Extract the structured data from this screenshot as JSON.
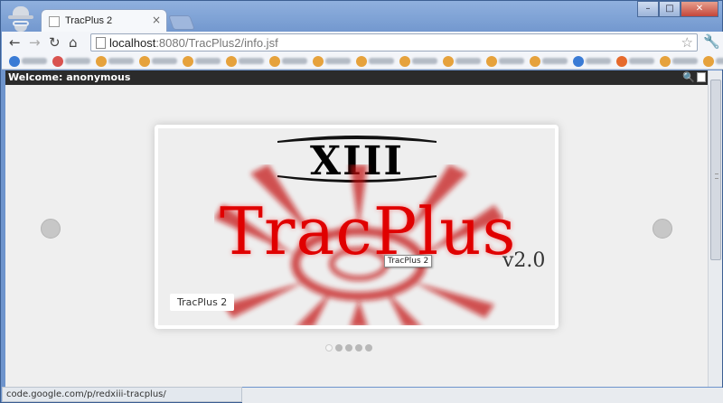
{
  "browser": {
    "tab_title": "TracPlus 2",
    "tab_close": "×",
    "url_host": "localhost",
    "url_rest": ":8080/TracPlus2/info.jsf",
    "window_controls": {
      "minimize": "–",
      "maximize": "□",
      "close": "✕"
    },
    "nav": {
      "back": "←",
      "forward": "→",
      "reload": "↻",
      "home": "⌂",
      "star": "☆",
      "wrench": "🔧"
    },
    "status_text": "code.google.com/p/redxiii-tracplus/"
  },
  "bookmark_icon_colors": [
    "#3a7bd5",
    "#d9534f",
    "#e6a23c",
    "#e6a23c",
    "#e6a23c",
    "#e6a23c",
    "#e6a23c",
    "#e6a23c",
    "#e6a23c",
    "#e6a23c",
    "#e6a23c",
    "#e6a23c",
    "#e6a23c",
    "#3a7bd5",
    "#e66a2c",
    "#e6a23c",
    "#e6a23c"
  ],
  "page": {
    "welcome": "Welcome: anonymous",
    "slider": {
      "logo_text": "XIII",
      "title": "TracPlus",
      "version": "v2.0",
      "tooltip": "TracPlus 2",
      "caption": "TracPlus 2",
      "dot_count": 5,
      "active_dot": 0
    }
  },
  "colors": {
    "title_red": "#e00000",
    "welcome_bar": "#2b2b2b"
  }
}
